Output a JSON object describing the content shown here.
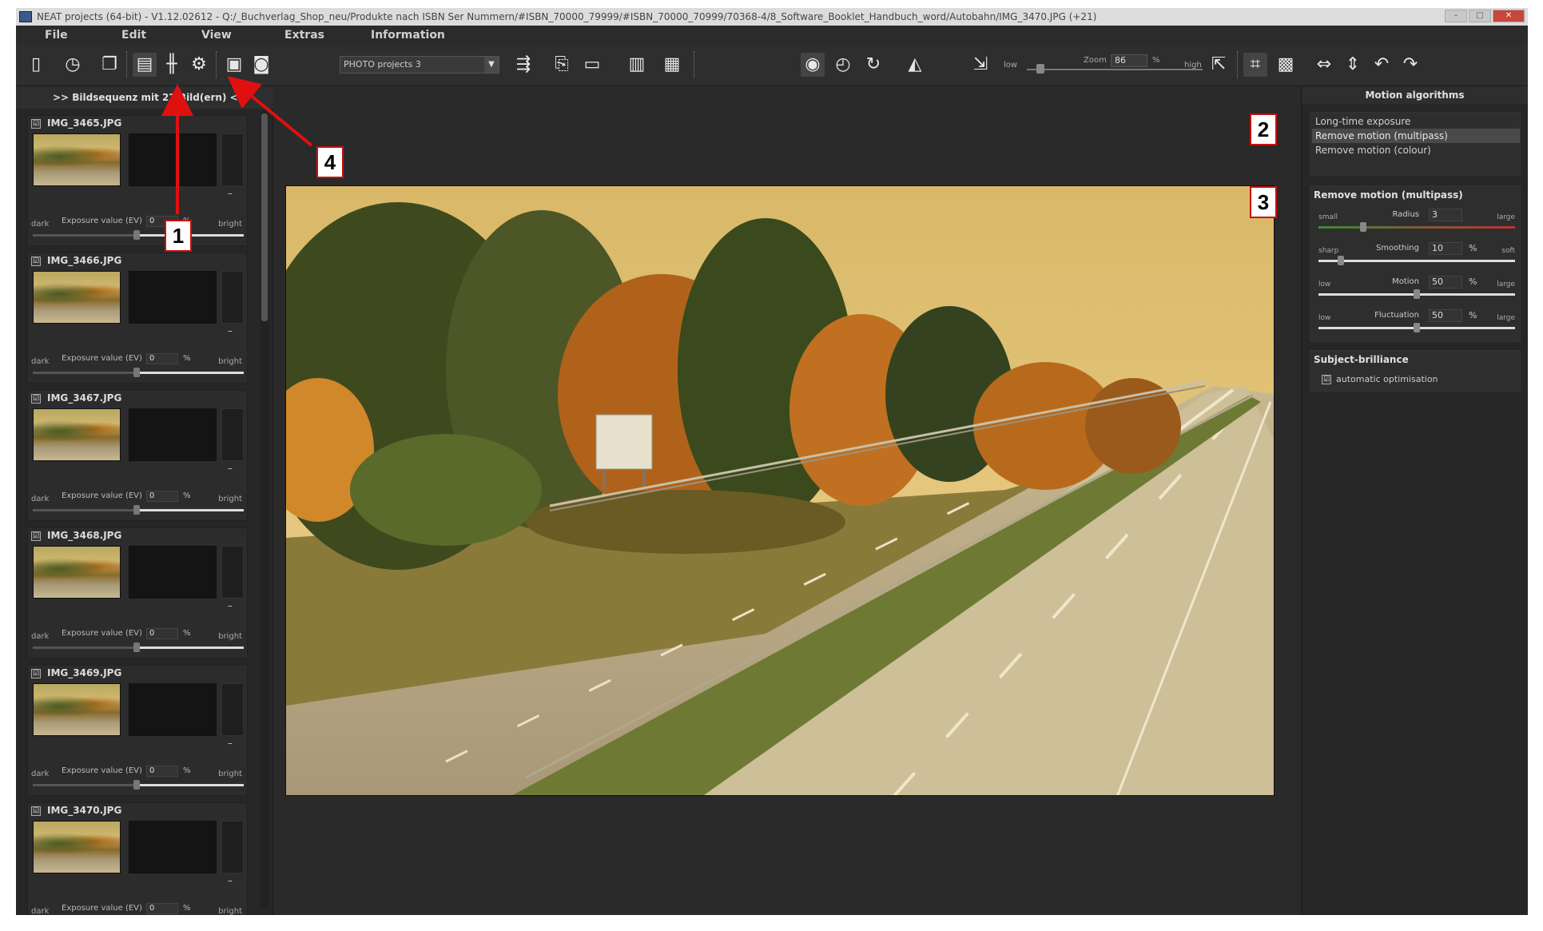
{
  "window": {
    "title": "NEAT projects (64-bit) - V1.12.02612 - Q:/_Buchverlag_Shop_neu/Produkte nach ISBN Ser Nummern/#ISBN_70000_79999/#ISBN_70000_70999/70368-4/8_Software_Booklet_Handbuch_word/Autobahn/IMG_3470.JPG (+21)"
  },
  "menu": {
    "items": [
      "File",
      "Edit",
      "View",
      "Extras",
      "Information"
    ]
  },
  "toolbar": {
    "project_select": "PHOTO projects 3",
    "zoom_low": "low",
    "zoom_label": "Zoom",
    "zoom_value": "86",
    "zoom_unit": "%",
    "zoom_high": "high"
  },
  "sequence": {
    "header": ">> Bildsequenz mit 22 Bild(ern) <<",
    "items": [
      {
        "name": "IMG_3465.JPG",
        "checked": "☑",
        "ev_label": "Exposure value (EV)",
        "ev_value": "0",
        "pct": "%",
        "dark": "dark",
        "bright": "bright"
      },
      {
        "name": "IMG_3466.JPG",
        "checked": "☑",
        "ev_label": "Exposure value (EV)",
        "ev_value": "0",
        "pct": "%",
        "dark": "dark",
        "bright": "bright"
      },
      {
        "name": "IMG_3467.JPG",
        "checked": "☑",
        "ev_label": "Exposure value (EV)",
        "ev_value": "0",
        "pct": "%",
        "dark": "dark",
        "bright": "bright"
      },
      {
        "name": "IMG_3468.JPG",
        "checked": "☑",
        "ev_label": "Exposure value (EV)",
        "ev_value": "0",
        "pct": "%",
        "dark": "dark",
        "bright": "bright"
      },
      {
        "name": "IMG_3469.JPG",
        "checked": "☑",
        "ev_label": "Exposure value (EV)",
        "ev_value": "0",
        "pct": "%",
        "dark": "dark",
        "bright": "bright"
      },
      {
        "name": "IMG_3470.JPG",
        "checked": "☑",
        "ev_label": "Exposure value (EV)",
        "ev_value": "0",
        "pct": "%",
        "dark": "dark",
        "bright": "bright"
      }
    ]
  },
  "right_panel": {
    "header": "Motion algorithms",
    "algorithms": [
      "Long-time exposure",
      "Remove motion (multipass)",
      "Remove motion (colour)"
    ],
    "selected_algorithm": "Remove motion (multipass)",
    "params_title": "Remove motion (multipass)",
    "params": [
      {
        "name": "Radius",
        "value": "3",
        "unit": "",
        "low": "small",
        "high": "large",
        "level": 0.22
      },
      {
        "name": "Smoothing",
        "value": "10",
        "unit": "%",
        "low": "sharp",
        "high": "soft",
        "level": 0.1
      },
      {
        "name": "Motion",
        "value": "50",
        "unit": "%",
        "low": "low",
        "high": "large",
        "level": 0.5
      },
      {
        "name": "Fluctuation",
        "value": "50",
        "unit": "%",
        "low": "low",
        "high": "large",
        "level": 0.5
      }
    ],
    "brilliance_title": "Subject-brilliance",
    "auto_optimisation": "automatic optimisation",
    "auto_checked": "☑"
  },
  "callouts": [
    "1",
    "2",
    "3",
    "4"
  ],
  "colors": {
    "callout_border": "#c81010",
    "arrow": "#e01010",
    "panel_bg": "#262626"
  },
  "icons": [
    "new-document-icon",
    "history-icon",
    "copy-icon",
    "image-stack-icon",
    "sliders-icon",
    "settings-grid-icon",
    "save-icon",
    "projects-icon",
    "export-icon",
    "filmstrip-icon",
    "calculator-icon",
    "histogram-icon",
    "eye-icon",
    "timer-icon",
    "redo-icon",
    "mirror-icon",
    "zoom-out-icon",
    "zoom-in-icon",
    "crop-icon",
    "frame-icon",
    "fit-width-icon",
    "fit-height-icon",
    "rotate-left-icon",
    "rotate-right-icon"
  ]
}
